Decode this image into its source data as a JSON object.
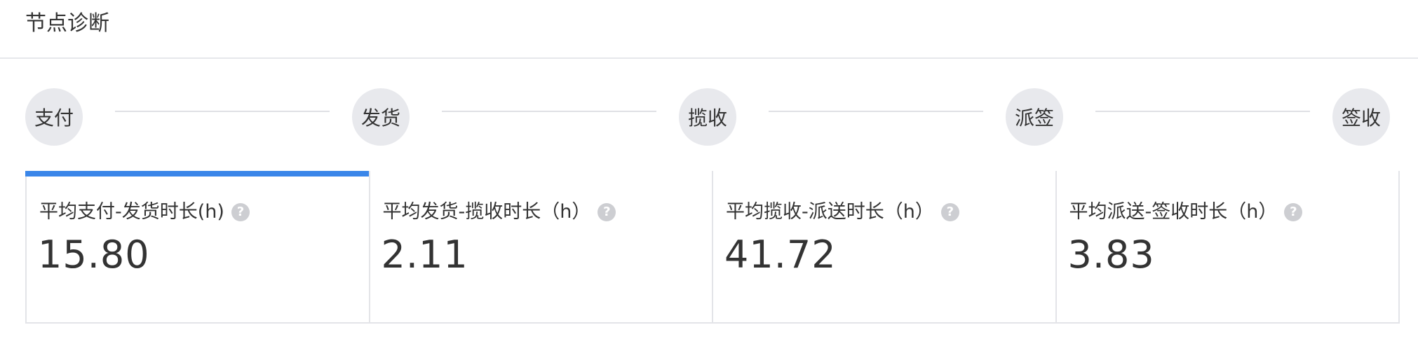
{
  "header": {
    "title": "节点诊断"
  },
  "flow": {
    "nodes": [
      "支付",
      "发货",
      "揽收",
      "派签",
      "签收"
    ]
  },
  "metrics": [
    {
      "label": "平均支付-发货时长(h)",
      "value": "15.80",
      "icon": "question-icon",
      "active": true
    },
    {
      "label": "平均发货-揽收时长（h）",
      "value": "2.11",
      "icon": "question-icon",
      "active": false
    },
    {
      "label": "平均揽收-派送时长（h）",
      "value": "41.72",
      "icon": "question-icon",
      "active": false
    },
    {
      "label": "平均派送-签收时长（h）",
      "value": "3.83",
      "icon": "question-icon",
      "active": false
    }
  ],
  "colors": {
    "accent": "#3a86e9",
    "node_bg": "#e8e9ed",
    "border": "#e3e4e8"
  }
}
